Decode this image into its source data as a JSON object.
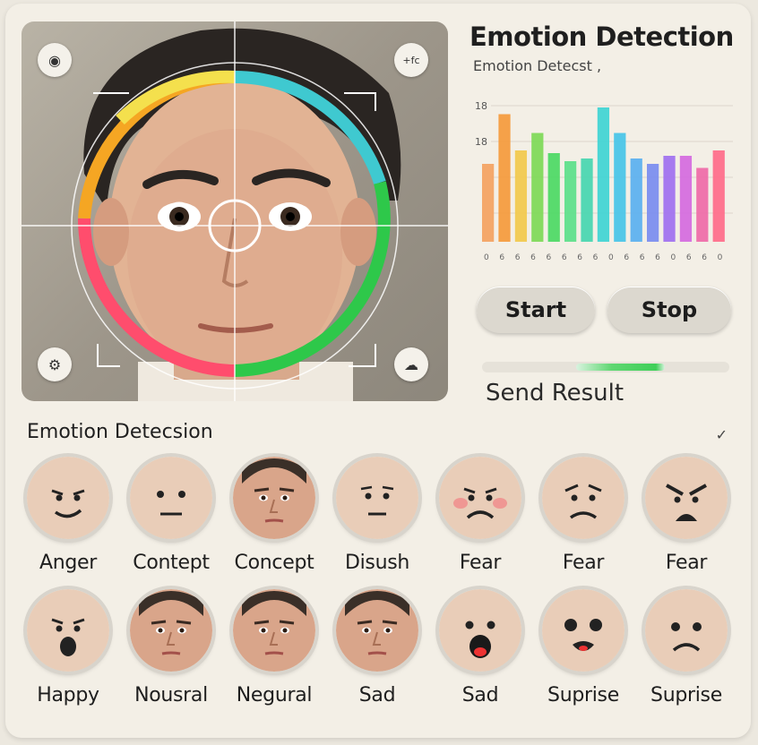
{
  "header": {
    "title": "Emotion Detection",
    "subtitle": "Emotion Detecst ,"
  },
  "camera": {
    "top_left_icon": "camera-switch-icon",
    "top_right_text": "+fc",
    "bottom_left_icon": "settings-icon",
    "bottom_right_icon": "cloud-icon"
  },
  "chart_data": {
    "type": "bar",
    "ytick_labels": [
      "18",
      "18"
    ],
    "xtick_labels": [
      "0",
      "6",
      "6",
      "6",
      "6",
      "6",
      "6",
      "6",
      "0",
      "6",
      "6",
      "6",
      "0",
      "6",
      "6",
      "0"
    ],
    "values": [
      58,
      95,
      68,
      81,
      66,
      60,
      62,
      100,
      81,
      62,
      58,
      64,
      64,
      55,
      68
    ],
    "colors": [
      "#f4a261",
      "#f59a3c",
      "#f2c94c",
      "#7ed957",
      "#4cd964",
      "#5ce08a",
      "#46d6b0",
      "#3fd4d4",
      "#47c4e8",
      "#5ab0f0",
      "#7a8cf0",
      "#a070f0",
      "#d56ae0",
      "#ef6aa8",
      "#ff6b8a"
    ]
  },
  "controls": {
    "start_label": "Start",
    "stop_label": "Stop",
    "send_label": "Send Result",
    "progress": 0.55
  },
  "section": {
    "title": "Emotion Detecsion",
    "icon": "check-icon"
  },
  "emotions_row1": [
    {
      "label": "Anger",
      "style": "smirk"
    },
    {
      "label": "Contept",
      "style": "neutral"
    },
    {
      "label": "Concept",
      "style": "photo"
    },
    {
      "label": "Disush",
      "style": "skeptic"
    },
    {
      "label": "Fear",
      "style": "sad-blush"
    },
    {
      "label": "Fear",
      "style": "worried"
    },
    {
      "label": "Fear",
      "style": "angry"
    }
  ],
  "emotions_row2": [
    {
      "label": "Happy",
      "style": "shocked"
    },
    {
      "label": "Nousral",
      "style": "photo"
    },
    {
      "label": "Negural",
      "style": "photo"
    },
    {
      "label": "Sad",
      "style": "photo"
    },
    {
      "label": "Sad",
      "style": "scream"
    },
    {
      "label": "Suprise",
      "style": "gasp"
    },
    {
      "label": "Suprise",
      "style": "frown"
    }
  ]
}
